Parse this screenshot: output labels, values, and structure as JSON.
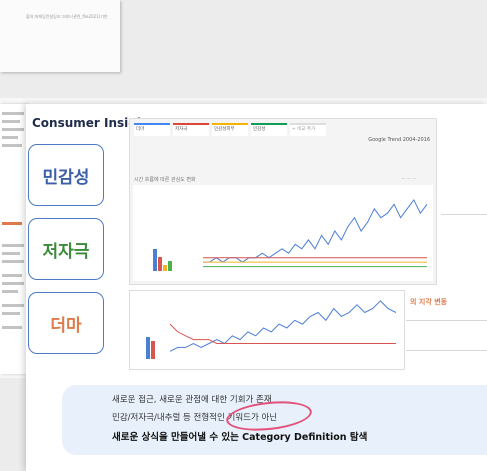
{
  "background_doc": {
    "caption": "출처:마케팅컨설팅조그레드(관련_file2021)기반"
  },
  "slide": {
    "title": "Consumer Insigh",
    "keywords": [
      {
        "label": "민감성",
        "color": "#3b5fa8"
      },
      {
        "label": "저자극",
        "color": "#3a8a3a"
      },
      {
        "label": "더마",
        "color": "#e07a4a"
      }
    ],
    "trends_panel": {
      "tabs": [
        {
          "label": "더마",
          "color": "#4285f4"
        },
        {
          "label": "저자극",
          "color": "#db4437"
        },
        {
          "label": "민감성피부",
          "color": "#f4b400"
        },
        {
          "label": "민감성",
          "color": "#0f9d58"
        },
        {
          "label": "+ 비교 추가",
          "color": "#dddddd"
        }
      ],
      "source_label": "Google Trend 2004-2016",
      "caption": "시간 흐름에 따른 관심도 변화"
    },
    "side_label": "의 지각 변동",
    "banner": {
      "line1": "새로운 접근, 새로운 관점에 대한 기회가 존재",
      "line2": "민감/저자극/내추럴 등 전형적인 키워드가 아닌",
      "line3_prefix": "새로운 상식을 만들어낼 수 있는 ",
      "line3_highlight": "Category Definition",
      "line3_suffix": " 탐색"
    }
  },
  "chart_data": [
    {
      "type": "line",
      "series": [
        {
          "color": "#4a7fd6",
          "values": [
            2,
            2,
            3,
            2,
            3,
            3,
            2,
            3,
            3,
            4,
            3,
            4,
            5,
            4,
            6,
            5,
            7,
            5,
            8,
            6,
            9,
            7,
            10,
            12,
            9,
            11,
            14,
            12,
            13,
            15,
            12,
            14,
            16,
            13,
            15
          ]
        },
        {
          "color": "#d9534f",
          "values": [
            3,
            3,
            3,
            3,
            3,
            3,
            3,
            3,
            3,
            3,
            3,
            3,
            3,
            3,
            3,
            3,
            3,
            3,
            3,
            3,
            3,
            3,
            3,
            3,
            3,
            3,
            3,
            3,
            3,
            3,
            3,
            3,
            3,
            3,
            3
          ]
        },
        {
          "color": "#f0b429",
          "values": [
            2,
            2,
            2,
            2,
            2,
            2,
            2,
            2,
            2,
            2,
            2,
            2,
            2,
            2,
            2,
            2,
            2,
            2,
            2,
            2,
            2,
            2,
            2,
            2,
            2,
            2,
            2,
            2,
            2,
            2,
            2,
            2,
            2,
            2,
            2
          ]
        },
        {
          "color": "#4caf50",
          "values": [
            1,
            1,
            1,
            1,
            1,
            1,
            1,
            1,
            1,
            1,
            1,
            1,
            1,
            1,
            1,
            1,
            1,
            1,
            1,
            1,
            1,
            1,
            1,
            1,
            1,
            1,
            1,
            1,
            1,
            1,
            1,
            1,
            1,
            1,
            1
          ]
        }
      ],
      "ylim": [
        0,
        18
      ]
    },
    {
      "type": "line",
      "series": [
        {
          "color": "#4a7fd6",
          "values": [
            2,
            3,
            3,
            4,
            3,
            4,
            5,
            4,
            6,
            5,
            7,
            6,
            8,
            7,
            9,
            8,
            10,
            9,
            11,
            12,
            10,
            13,
            11,
            12,
            14,
            12,
            13,
            15,
            13,
            12
          ]
        },
        {
          "color": "#d9534f",
          "values": [
            9,
            7,
            6,
            5,
            5,
            5,
            4,
            4,
            4,
            4,
            4,
            4,
            4,
            4,
            4,
            4,
            4,
            4,
            4,
            4,
            4,
            4,
            4,
            4,
            4,
            4,
            4,
            4,
            4,
            4
          ]
        }
      ],
      "ylim": [
        0,
        16
      ]
    }
  ]
}
